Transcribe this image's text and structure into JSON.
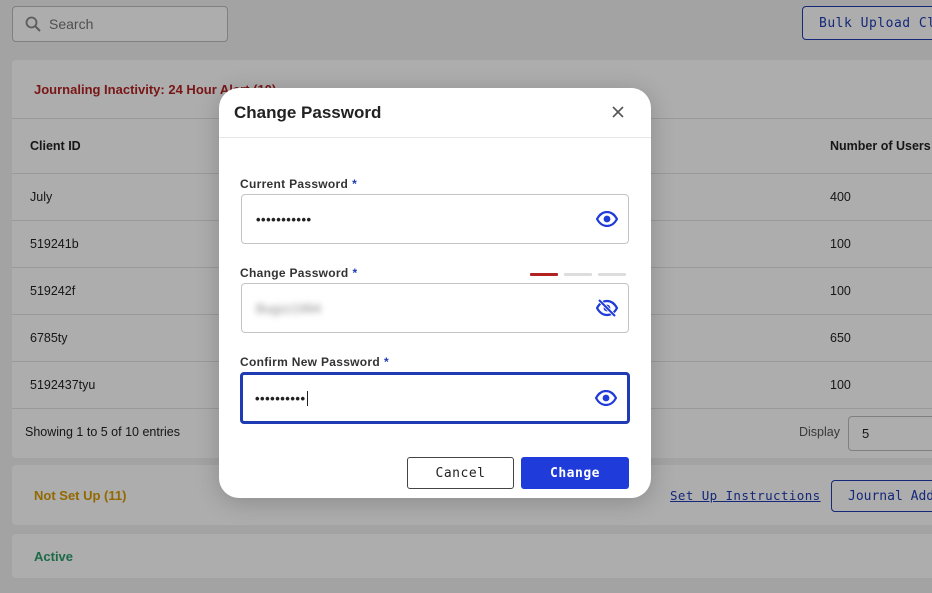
{
  "search": {
    "placeholder": "Search"
  },
  "header": {
    "bulk_upload_label": "Bulk Upload Clients"
  },
  "alert_section": {
    "title": "Journaling Inactivity: 24 Hour Alert (10)",
    "columns": {
      "client_id": "Client ID",
      "users": "Number of Users"
    },
    "rows": [
      {
        "client_id": "July",
        "users": "400"
      },
      {
        "client_id": "519241b",
        "users": "100"
      },
      {
        "client_id": "519242f",
        "users": "100"
      },
      {
        "client_id": "6785ty",
        "users": "650"
      },
      {
        "client_id": "5192437tyu",
        "users": "100"
      }
    ],
    "showing": "Showing 1 to 5 of 10 entries",
    "display_label": "Display",
    "display_value": "5"
  },
  "not_set_up_section": {
    "title": "Not Set Up (11)",
    "setup_link": "Set Up Instructions",
    "journal_button": "Journal Address"
  },
  "active_section": {
    "title": "Active"
  },
  "modal": {
    "title": "Change Password",
    "current_password": {
      "label": "Current Password",
      "required": "*",
      "value": "•••••••••••"
    },
    "change_password": {
      "label": "Change Password",
      "required": "*",
      "value": "Bugzz1994",
      "strength_level": 1,
      "strength_max": 3
    },
    "confirm_password": {
      "label": "Confirm New Password",
      "required": "*",
      "value": "••••••••••"
    },
    "cancel_label": "Cancel",
    "change_label": "Change"
  },
  "colors": {
    "accent": "#1f3bd9",
    "alert": "#b32222",
    "warning": "#d99a00",
    "active": "#2a9d6a"
  }
}
